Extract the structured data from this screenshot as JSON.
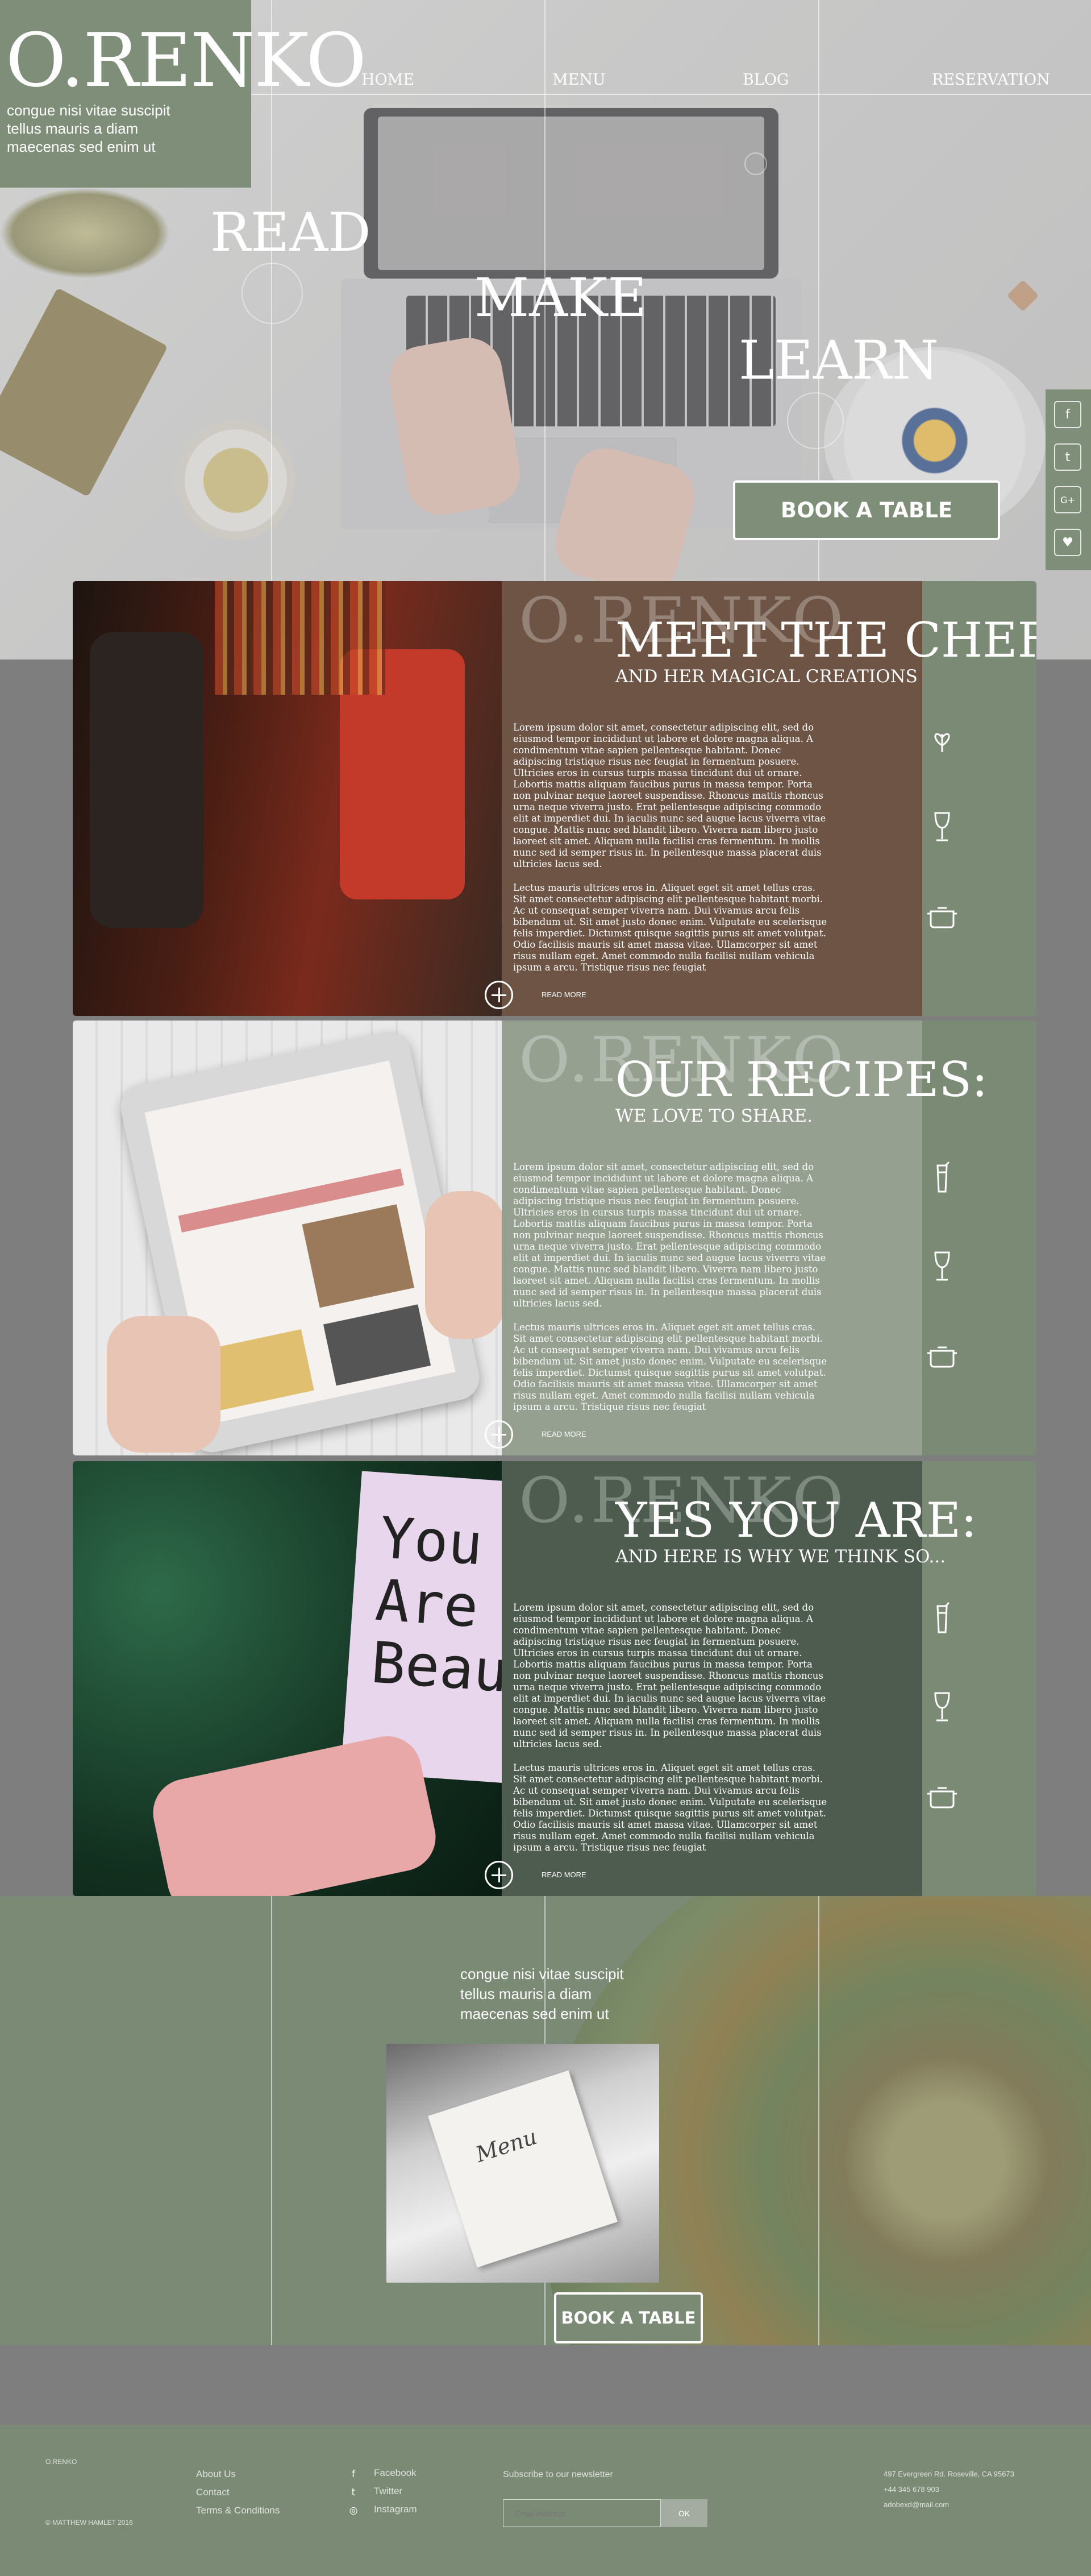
{
  "brand": {
    "logo": "O.RENKO",
    "tagline_lines": [
      "congue nisi vitae suscipit",
      "tellus mauris a diam",
      "maecenas sed enim ut"
    ]
  },
  "nav": {
    "items": [
      {
        "label": "HOME"
      },
      {
        "label": "MENU"
      },
      {
        "label": "BLOG"
      },
      {
        "label": "RESERVATION"
      }
    ]
  },
  "hero": {
    "words": [
      "READ",
      "MAKE",
      "LEARN"
    ],
    "cta_label": "BOOK A TABLE"
  },
  "social": {
    "icons": [
      "facebook-icon",
      "twitter-icon",
      "google-plus-icon",
      "heart-icon"
    ],
    "glyphs": [
      "f",
      "t",
      "G+",
      "♥"
    ]
  },
  "sections": [
    {
      "ghost": "O.RENKO",
      "title": "MEET THE CHEF",
      "subtitle": "AND HER MAGICAL CREATIONS",
      "paragraphs": [
        "Lorem ipsum dolor sit amet, consectetur adipiscing elit, sed do eiusmod tempor incididunt ut labore et dolore magna aliqua. A condimentum vitae sapien pellentesque habitant. Donec adipiscing tristique risus nec feugiat in fermentum posuere. Ultricies eros in cursus turpis massa tincidunt dui ut ornare. Lobortis mattis aliquam faucibus purus in massa tempor. Porta non pulvinar neque laoreet suspendisse. Rhoncus mattis rhoncus urna neque viverra justo. Erat pellentesque adipiscing commodo elit at imperdiet dui. In iaculis nunc sed augue lacus viverra vitae congue. Mattis nunc sed blandit libero. Viverra nam libero justo laoreet sit amet. Aliquam nulla facilisi cras fermentum. In mollis nunc sed id semper risus in. In pellentesque massa placerat duis ultricies lacus sed.",
        "Lectus mauris ultrices eros in. Aliquet eget sit amet tellus cras. Sit amet consectetur adipiscing elit pellentesque habitant morbi. Ac ut consequat semper viverra nam. Dui vivamus arcu felis bibendum ut. Sit amet justo donec enim. Vulputate eu scelerisque felis imperdiet. Dictumst quisque sagittis purus sit amet volutpat. Odio facilisis mauris sit amet massa vitae. Ullamcorper sit amet risus nullam eget. Amet commodo nulla facilisi nullam vehicula ipsum a arcu. Tristique risus nec feugiat"
      ],
      "read_more": "READ MORE",
      "icons": [
        "leaf-icon",
        "wine-glass-icon",
        "pot-icon"
      ]
    },
    {
      "ghost": "O.RENKO",
      "title": "OUR RECIPES:",
      "subtitle": "WE LOVE TO SHARE.",
      "paragraphs": [
        "Lorem ipsum dolor sit amet, consectetur adipiscing elit, sed do eiusmod tempor incididunt ut labore et dolore magna aliqua. A condimentum vitae sapien pellentesque habitant. Donec adipiscing tristique risus nec feugiat in fermentum posuere. Ultricies eros in cursus turpis massa tincidunt dui ut ornare. Lobortis mattis aliquam faucibus purus in massa tempor. Porta non pulvinar neque laoreet suspendisse. Rhoncus mattis rhoncus urna neque viverra justo. Erat pellentesque adipiscing commodo elit at imperdiet dui. In iaculis nunc sed augue lacus viverra vitae congue. Mattis nunc sed blandit libero. Viverra nam libero justo laoreet sit amet. Aliquam nulla facilisi cras fermentum. In mollis nunc sed id semper risus in. In pellentesque massa placerat duis ultricies lacus sed.",
        "Lectus mauris ultrices eros in. Aliquet eget sit amet tellus cras. Sit amet consectetur adipiscing elit pellentesque habitant morbi. Ac ut consequat semper viverra nam. Dui vivamus arcu felis bibendum ut. Sit amet justo donec enim. Vulputate eu scelerisque felis imperdiet. Dictumst quisque sagittis purus sit amet volutpat. Odio facilisis mauris sit amet massa vitae. Ullamcorper sit amet risus nullam eget. Amet commodo nulla facilisi nullam vehicula ipsum a arcu. Tristique risus nec feugiat"
      ],
      "read_more": "READ MORE",
      "icons": [
        "cocktail-icon",
        "wine-glass-icon",
        "pot-icon"
      ]
    },
    {
      "ghost": "O.RENKO",
      "title": "YES YOU ARE:",
      "subtitle": "AND HERE IS WHY WE THINK SO...",
      "paragraphs": [
        "Lorem ipsum dolor sit amet, consectetur adipiscing elit, sed do eiusmod tempor incididunt ut labore et dolore magna aliqua. A condimentum vitae sapien pellentesque habitant. Donec adipiscing tristique risus nec feugiat in fermentum posuere. Ultricies eros in cursus turpis massa tincidunt dui ut ornare. Lobortis mattis aliquam faucibus purus in massa tempor. Porta non pulvinar neque laoreet suspendisse. Rhoncus mattis rhoncus urna neque viverra justo. Erat pellentesque adipiscing commodo elit at imperdiet dui. In iaculis nunc sed augue lacus viverra vitae congue. Mattis nunc sed blandit libero. Viverra nam libero justo laoreet sit amet. Aliquam nulla facilisi cras fermentum. In mollis nunc sed id semper risus in. In pellentesque massa placerat duis ultricies lacus sed.",
        "Lectus mauris ultrices eros in. Aliquet eget sit amet tellus cras. Sit amet consectetur adipiscing elit pellentesque habitant morbi. Ac ut consequat semper viverra nam. Dui vivamus arcu felis bibendum ut. Sit amet justo donec enim. Vulputate eu scelerisque felis imperdiet. Dictumst quisque sagittis purus sit amet volutpat. Odio facilisis mauris sit amet massa vitae. Ullamcorper sit amet risus nullam eget. Amet commodo nulla facilisi nullam vehicula ipsum a arcu. Tristique risus nec feugiat"
      ],
      "read_more": "READ MORE",
      "icons": [
        "cocktail-icon",
        "wine-glass-icon",
        "pot-icon"
      ]
    }
  ],
  "bottom": {
    "tagline_lines": [
      "congue nisi vitae suscipit",
      "tellus mauris a diam",
      "maecenas sed enim ut"
    ],
    "menu_card_text": "Menu",
    "cta_label": "BOOK A TABLE"
  },
  "footer": {
    "brand": "O.RENKO",
    "copyright": "© MATTHEW HAMLET 2016",
    "links": [
      "About Us",
      "Contact",
      "Terms & Conditions"
    ],
    "social": [
      {
        "label": "Facebook",
        "glyph": "f",
        "icon": "facebook-icon"
      },
      {
        "label": "Twitter",
        "glyph": "t",
        "icon": "twitter-icon"
      },
      {
        "label": "Instagram",
        "glyph": "◎",
        "icon": "instagram-icon"
      }
    ],
    "newsletter_label": "Subscribe to our newsletter",
    "email_placeholder": "Email Address",
    "submit_label": "OK",
    "address": [
      "497 Evergreen Rd. Roseville, CA 95673",
      "+44 345 678 903",
      "adobexd@mail.com"
    ]
  },
  "colors": {
    "sage": "#7b8a75",
    "gray": "#7e7e7e",
    "white": "#ffffff"
  }
}
